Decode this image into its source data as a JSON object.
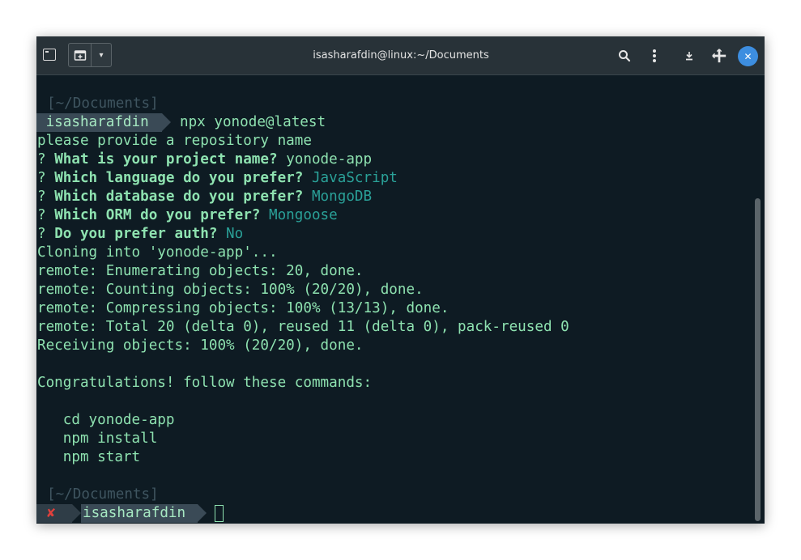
{
  "window": {
    "title": "isasharafdin@linux:~/Documents"
  },
  "toolbar": {
    "new_tab_dropdown_glyph": "▾",
    "search_glyph": "⌕",
    "menu_glyph": "⋮",
    "close_glyph": "✕"
  },
  "terminal": {
    "prompt_dir_1": "[~/Documents]",
    "prompt_user_1": " isasharafdin",
    "command_1": "npx yonode@latest",
    "output": {
      "repo_prompt": "please provide a repository name",
      "q_mark": "?",
      "q1_label": "What is your project name?",
      "q1_answer": "yonode-app",
      "q2_label": "Which language do you prefer?",
      "q2_answer": "JavaScript",
      "q3_label": "Which database do you prefer?",
      "q3_answer": "MongoDB",
      "q4_label": "Which ORM do you prefer?",
      "q4_answer": "Mongoose",
      "q5_label": "Do you prefer auth?",
      "q5_answer": "No",
      "clone_1": "Cloning into 'yonode-app'...",
      "clone_2": "remote: Enumerating objects: 20, done.",
      "clone_3": "remote: Counting objects: 100% (20/20), done.",
      "clone_4": "remote: Compressing objects: 100% (13/13), done.",
      "clone_5": "remote: Total 20 (delta 0), reused 11 (delta 0), pack-reused 0",
      "clone_6": "Receiving objects: 100% (20/20), done.",
      "congrats": "Congratulations! follow these commands:",
      "cmd_1": "   cd yonode-app",
      "cmd_2": "   npm install",
      "cmd_3": "   npm start"
    },
    "prompt_dir_2": "[~/Documents]",
    "prompt_error_glyph": "✘",
    "prompt_user_2": "isasharafdin"
  }
}
